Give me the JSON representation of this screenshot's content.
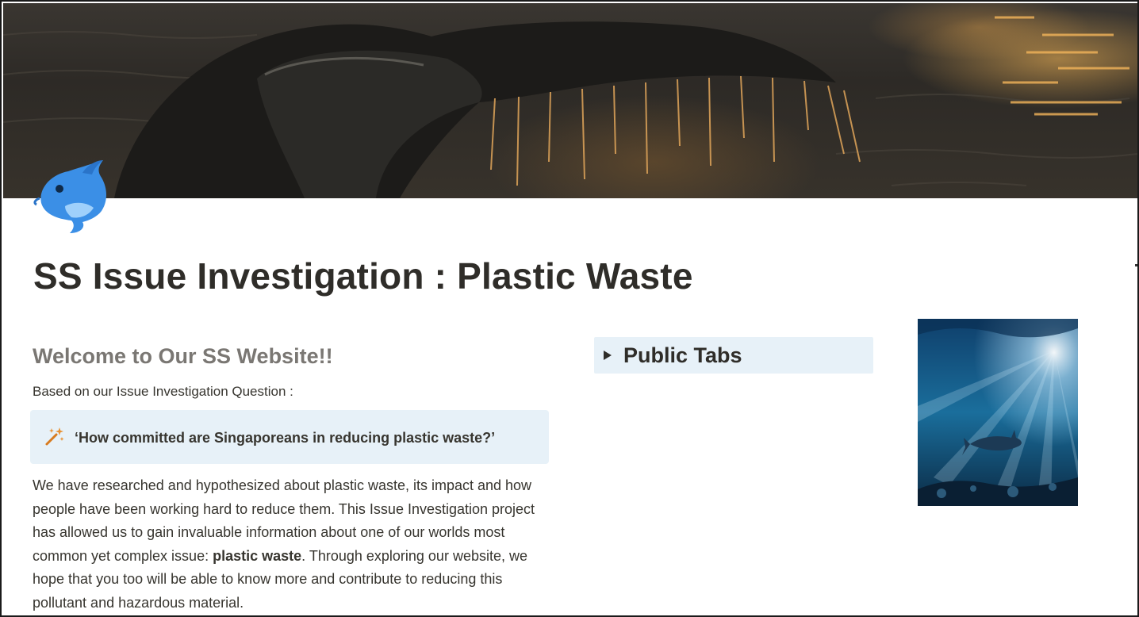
{
  "page": {
    "title": "SS Issue Investigation : Plastic Waste",
    "cover_alt": "whale-tail-cover",
    "icon": "dolphin-icon"
  },
  "left": {
    "heading": "Welcome to Our SS Website!!",
    "intro": "Based on our Issue Investigation Question :",
    "callout": {
      "icon": "sparkles-wand-icon",
      "text": "‘How committed are Singaporeans in reducing plastic waste?’"
    },
    "paragraph": {
      "before": "We have researched and hypothesized about plastic waste, its impact and how people have been working hard to reduce them. This Issue Investigation project has allowed us to gain invaluable information about one of our worlds most common yet complex issue: ",
      "bold": "plastic waste",
      "after": ". Through exploring our website, we hope that you too will be able to know more and contribute to reducing this pollutant and hazardous material."
    }
  },
  "middle": {
    "toggle_label": "Public Tabs",
    "toggle_icon": "triangle-right-icon"
  },
  "right": {
    "image": "underwater-shark-image"
  },
  "colors": {
    "callout_bg": "#e7f1f8",
    "title": "#2f2d29",
    "heading_gray": "#7a7773",
    "dolphin": "#3b8fe6"
  }
}
